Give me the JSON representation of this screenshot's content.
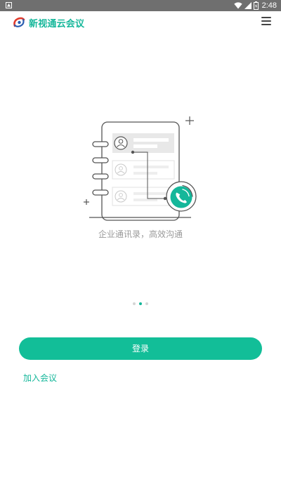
{
  "status_bar": {
    "time": "2:48"
  },
  "app_bar": {
    "title": "新视通云会议"
  },
  "onboarding": {
    "caption": "企业通讯录，高效沟通",
    "page_count": 3,
    "active_page": 2
  },
  "actions": {
    "login_label": "登录",
    "join_label": "加入会议"
  },
  "colors": {
    "accent": "#12be98",
    "status_bar": "#6f6f6f",
    "caption_text": "#9a9a9a"
  }
}
